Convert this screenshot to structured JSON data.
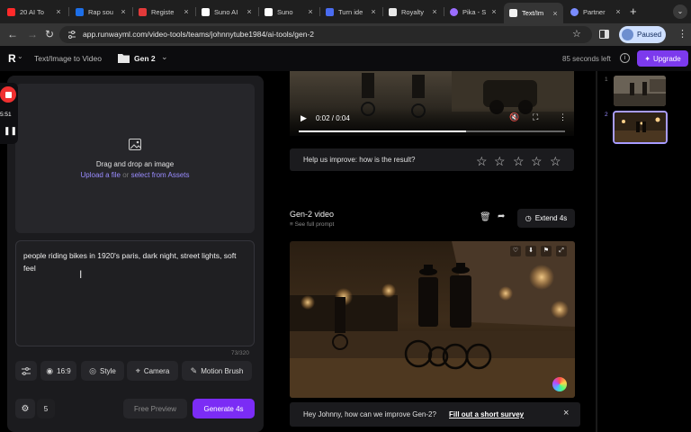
{
  "browser": {
    "tabs": [
      {
        "label": "20 AI To",
        "fav_color": "#ff2a2a"
      },
      {
        "label": "Rap sou",
        "fav_color": "#1d6fe8"
      },
      {
        "label": "Registe",
        "fav_color": "#e23a3a"
      },
      {
        "label": "Suno AI",
        "fav_color": "#ffffff"
      },
      {
        "label": "Suno",
        "fav_color": "#ffffff"
      },
      {
        "label": "Turn ide",
        "fav_color": "#4a6cf0"
      },
      {
        "label": "Royalty",
        "fav_color": "#e8e8e8"
      },
      {
        "label": "Pika - S",
        "fav_color": "#9b6dff"
      },
      {
        "label": "Text/Im",
        "fav_color": "#f2f2f2"
      },
      {
        "label": "Partner",
        "fav_color": "#7a8cff"
      }
    ],
    "new_tab_symbol": "+",
    "url": "app.runwayml.com/video-tools/teams/johnnytube1984/ai-tools/gen-2",
    "profile_label": "Paused"
  },
  "appbar": {
    "logo": "R",
    "tool_title": "Text/Image to Video",
    "folder_label": "Gen 2",
    "credits": "85 seconds left",
    "upgrade_label": "Upgrade"
  },
  "recorder": {
    "time": "5:51"
  },
  "upload": {
    "title": "Drag and drop an image",
    "link1": "Upload a file",
    "or": "or",
    "link2": "select from Assets"
  },
  "prompt": {
    "text": "people riding bikes in 1920's paris, dark night, street lights, soft feel",
    "counter": "73/320"
  },
  "chips": {
    "ratio": "16:9",
    "style": "Style",
    "camera": "Camera",
    "motion": "Motion Brush",
    "count": "5"
  },
  "actions": {
    "preview": "Free Preview",
    "generate": "Generate 4s"
  },
  "player": {
    "time": "0:02 / 0:04",
    "progress": 0.63
  },
  "feedback": {
    "question": "Help us improve: how is the result?",
    "stars": 5
  },
  "gen2": {
    "title": "Gen-2 video",
    "see_prompt": "See full prompt",
    "extend": "Extend 4s"
  },
  "survey": {
    "text": "Hey Johnny, how can we improve Gen-2?",
    "link": "Fill out a short survey",
    "close": "×"
  },
  "thumbs": [
    {
      "index": "1"
    },
    {
      "index": "2"
    }
  ],
  "colors": {
    "accent": "#7c3aed",
    "generate_bg": "#7b2cf5",
    "link": "#9a8cff"
  }
}
